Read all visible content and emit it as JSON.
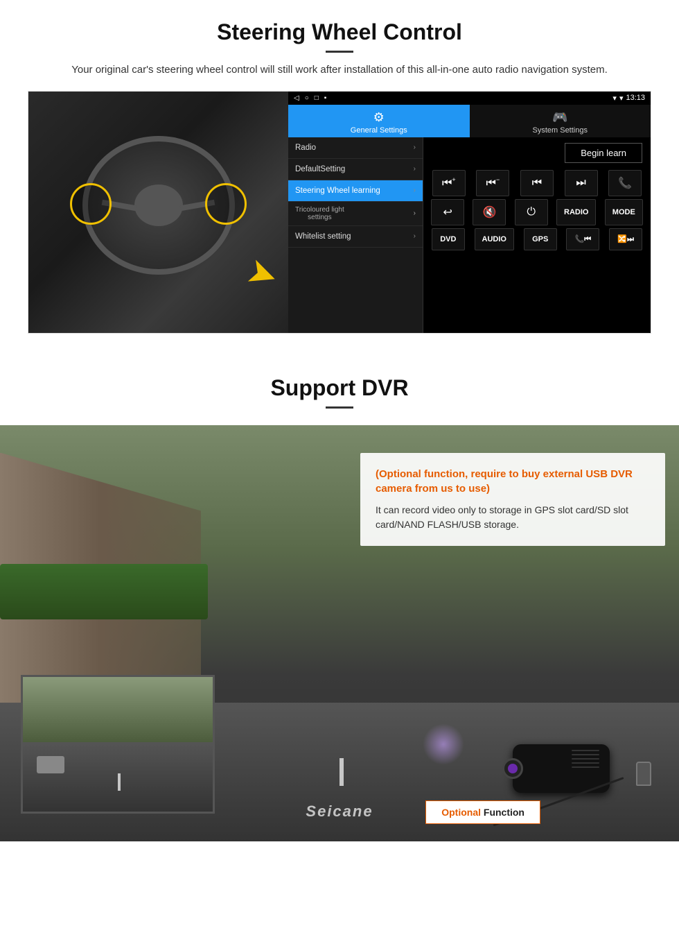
{
  "steering": {
    "title": "Steering Wheel Control",
    "description": "Your original car's steering wheel control will still work after installation of this all-in-one auto radio navigation system.",
    "ui": {
      "statusbar": {
        "time": "13:13",
        "wifi": "▾",
        "signal": "▾"
      },
      "tabs": {
        "general": "General Settings",
        "system": "System Settings",
        "general_icon": "⚙",
        "system_icon": "🎮"
      },
      "menu": [
        {
          "label": "Radio",
          "active": false
        },
        {
          "label": "DefaultSetting",
          "active": false
        },
        {
          "label": "Steering Wheel learning",
          "active": true
        },
        {
          "label": "Tricoloured light settings",
          "active": false
        },
        {
          "label": "Whitelist setting",
          "active": false
        }
      ],
      "begin_learn": "Begin learn",
      "controls_row1": [
        "⏮+",
        "⏮−",
        "⏮⏮",
        "⏭⏭",
        "📞"
      ],
      "controls_row2": [
        "↩",
        "🔇",
        "⏻",
        "RADIO",
        "MODE"
      ],
      "controls_row3": [
        "DVD",
        "AUDIO",
        "GPS",
        "📞⏮",
        "🔀⏭"
      ]
    }
  },
  "dvr": {
    "title": "Support DVR",
    "optional_text": "(Optional function, require to buy external USB DVR camera from us to use)",
    "description": "It can record video only to storage in GPS slot card/SD slot card/NAND FLASH/USB storage.",
    "optional_function_label_1": "Optional",
    "optional_function_label_2": "Function",
    "seicane": "Seicane"
  }
}
